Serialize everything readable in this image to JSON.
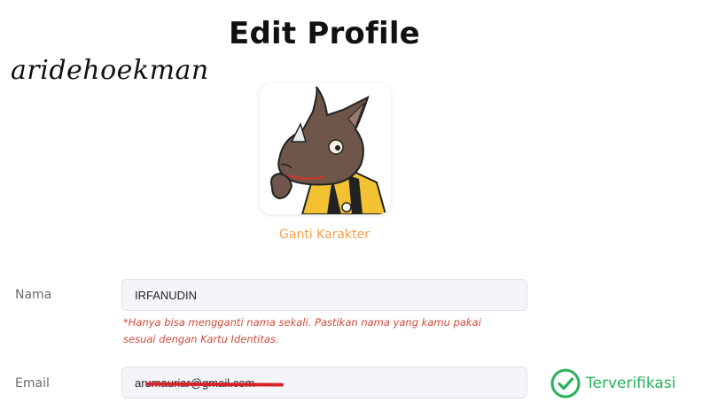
{
  "page": {
    "title": "Edit Profile",
    "watermark": "aridehoekman"
  },
  "avatar": {
    "change_label": "Ganti Karakter"
  },
  "form": {
    "name_label": "Nama",
    "name_value": "IRFANUDIN",
    "name_hint": "*Hanya bisa mengganti nama sekali. Pastikan nama yang kamu pakai sesuai dengan Kartu Identitas.",
    "email_label": "Email",
    "email_value": "arumauriar@gmail.com",
    "email_status": "Terverifikasi"
  },
  "colors": {
    "accent_orange": "#f3a04a",
    "verified_green": "#25b35a",
    "hint_red": "#d04a3a",
    "redaction_red": "#d8222a"
  }
}
